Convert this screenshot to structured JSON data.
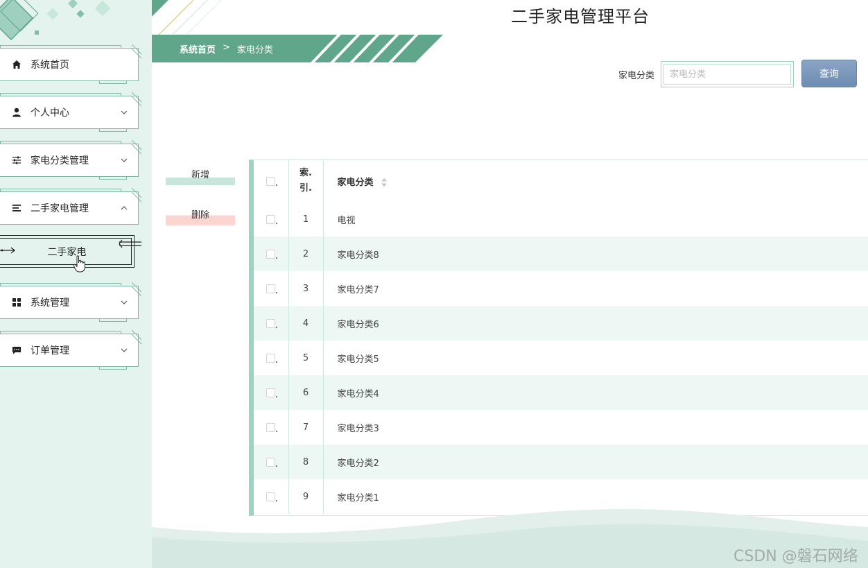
{
  "app": {
    "title": "二手家电管理平台"
  },
  "breadcrumb": {
    "home": "系统首页",
    "separator": ">",
    "current": "家电分类"
  },
  "sidebar": {
    "items": [
      {
        "label": "系统首页",
        "icon": "home-icon",
        "expandable": false
      },
      {
        "label": "个人中心",
        "icon": "user-icon",
        "expandable": true,
        "expanded": false
      },
      {
        "label": "家电分类管理",
        "icon": "sliders-icon",
        "expandable": true,
        "expanded": false
      },
      {
        "label": "二手家电管理",
        "icon": "list-icon",
        "expandable": true,
        "expanded": true
      },
      {
        "label": "系统管理",
        "icon": "grid-icon",
        "expandable": true,
        "expanded": false
      },
      {
        "label": "订单管理",
        "icon": "chat-icon",
        "expandable": true,
        "expanded": false
      }
    ],
    "submenu": {
      "label": "二手家电"
    }
  },
  "search": {
    "label": "家电分类",
    "placeholder": "家电分类",
    "value": "",
    "button": "查询"
  },
  "actions": {
    "add": "新增",
    "delete": "删除"
  },
  "table": {
    "headers": {
      "index": "索.引.",
      "index_line1": "索.",
      "index_line2": "引.",
      "name": "家电分类"
    },
    "rows": [
      {
        "index": "1",
        "name": "电视"
      },
      {
        "index": "2",
        "name": "家电分类8"
      },
      {
        "index": "3",
        "name": "家电分类7"
      },
      {
        "index": "4",
        "name": "家电分类6"
      },
      {
        "index": "5",
        "name": "家电分类5"
      },
      {
        "index": "6",
        "name": "家电分类4"
      },
      {
        "index": "7",
        "name": "家电分类3"
      },
      {
        "index": "8",
        "name": "家电分类2"
      },
      {
        "index": "9",
        "name": "家电分类1"
      }
    ]
  },
  "watermark": "CSDN @磐石网络",
  "colors": {
    "accent": "#5fa68a",
    "sidebar_bg": "#e4f3ee",
    "row_alt": "#edf7f3",
    "query_button": "#7b97bb",
    "delete_tint": "#fbd5d2",
    "add_tint": "#c8e6dc"
  }
}
